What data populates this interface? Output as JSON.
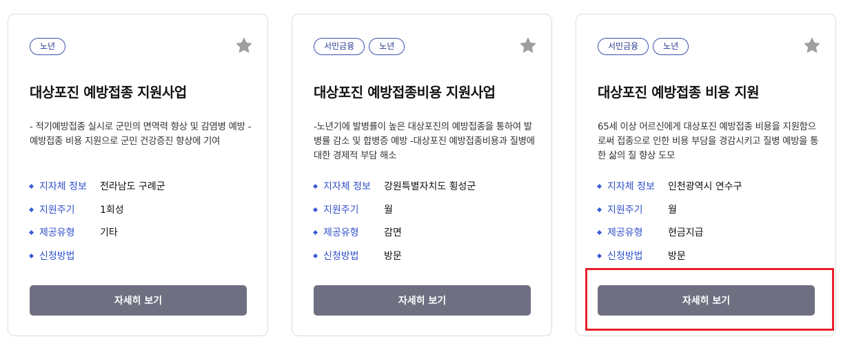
{
  "cards": [
    {
      "tags": [
        "노년"
      ],
      "title": "대상포진 예방접종 지원사업",
      "description": "- 적기예방접종 실시로 군민의 면역력 향상 및 감염병 예방 - 예방접종 비용 지원으로 군민 건강증진 향상에 기여",
      "info": [
        {
          "label": "지자체 정보",
          "value": "전라남도 구례군"
        },
        {
          "label": "지원주기",
          "value": "1회성"
        },
        {
          "label": "제공유형",
          "value": "기타"
        },
        {
          "label": "신청방법",
          "value": ""
        }
      ],
      "button_label": "자세히 보기"
    },
    {
      "tags": [
        "서민금융",
        "노년"
      ],
      "title": "대상포진 예방접종비용 지원사업",
      "description": "-노년기에 발병률이 높은 대상포진의 예방접종을 통하여 발병률 감소 및 합병증 예방 -대상포진 예방접종비용과 질병에 대한 경제적 부담 해소",
      "info": [
        {
          "label": "지자체 정보",
          "value": "강원특별자치도 횡성군"
        },
        {
          "label": "지원주기",
          "value": "월"
        },
        {
          "label": "제공유형",
          "value": "감면"
        },
        {
          "label": "신청방법",
          "value": "방문"
        }
      ],
      "button_label": "자세히 보기"
    },
    {
      "tags": [
        "서민금융",
        "노년"
      ],
      "title": "대상포진 예방접종 비용 지원",
      "description": "65세 이상 어르신에게 대상포진 예방접종 비용을 지원함으로써 접종으로 인한 비용 부담을 경감시키고 질병 예방을 통한 삶의 질 향상 도모",
      "info": [
        {
          "label": "지자체 정보",
          "value": "인천광역시 연수구"
        },
        {
          "label": "지원주기",
          "value": "월"
        },
        {
          "label": "제공유형",
          "value": "현금지급"
        },
        {
          "label": "신청방법",
          "value": "방문"
        }
      ],
      "button_label": "자세히 보기"
    }
  ],
  "icons": {
    "favorite": "star-icon"
  },
  "colors": {
    "tag_border": "#3b4fb0",
    "info_label": "#3050c8",
    "button_bg": "#6e7082",
    "star": "#9e9e9e",
    "highlight": "#e8202a"
  }
}
